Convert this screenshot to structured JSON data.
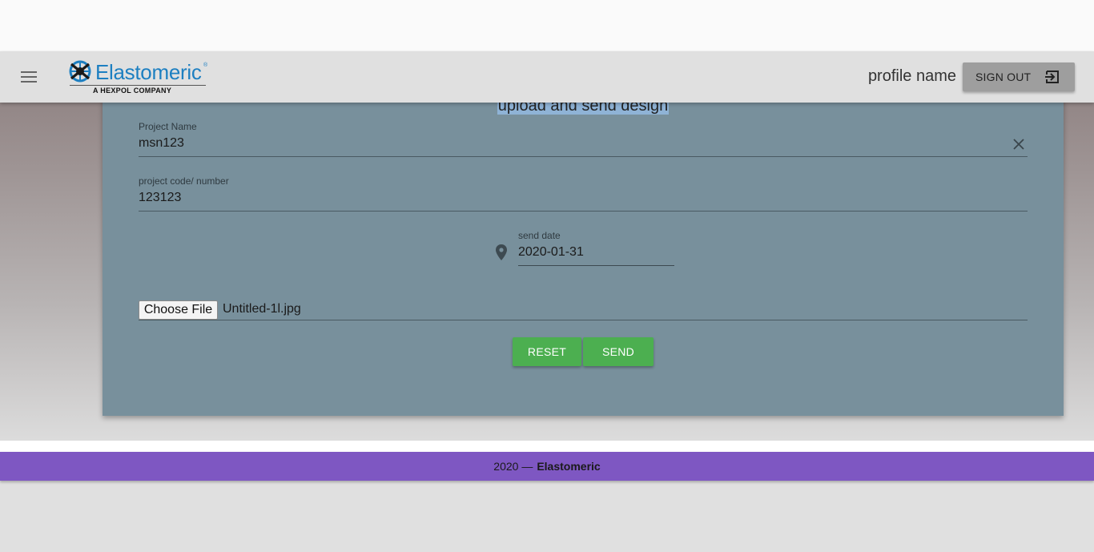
{
  "header": {
    "logo_text": "Elastomeric",
    "logo_registered": "®",
    "logo_subtitle": "A HEXPOL COMPANY",
    "profile_name": "profile name",
    "signout_label": "SIGN OUT",
    "menu_icon": "hamburger-menu-icon",
    "signout_icon": "exit-to-app-icon"
  },
  "form": {
    "title": "upload and send design",
    "project_name": {
      "label": "Project Name",
      "value": "msn123"
    },
    "project_code": {
      "label": "project code/ number",
      "value": "123123"
    },
    "send_date": {
      "label": "send date",
      "value": "2020-01-31"
    },
    "file": {
      "button_label": "Choose File",
      "file_name": "Untitled-1l.jpg"
    },
    "reset_label": "RESET",
    "send_label": "SEND"
  },
  "footer": {
    "year_text": "2020 —",
    "brand": "Elastomeric"
  },
  "colors": {
    "card": "#78909c",
    "button_green": "#4caf50",
    "footer_purple": "#7e57c2",
    "logo_blue": "#1d7fc1"
  }
}
